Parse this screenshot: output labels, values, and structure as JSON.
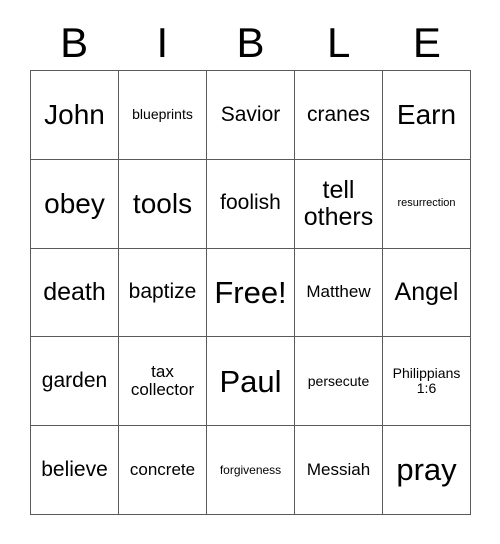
{
  "card": {
    "title_letters": [
      "B",
      "I",
      "B",
      "L",
      "E"
    ],
    "columns": 5,
    "rows": 5,
    "free_space_label": "Free!",
    "border_color": "#5a5a5a",
    "background_color": "#ffffff",
    "text_color": "#000000"
  },
  "grid": {
    "rows": [
      {
        "cells": [
          {
            "text": "John",
            "size": "sz-xl"
          },
          {
            "text": "blueprints",
            "size": "sz-xs"
          },
          {
            "text": "Savior",
            "size": "sz-md"
          },
          {
            "text": "cranes",
            "size": "sz-md"
          },
          {
            "text": "Earn",
            "size": "sz-xl"
          }
        ]
      },
      {
        "cells": [
          {
            "text": "obey",
            "size": "sz-xl"
          },
          {
            "text": "tools",
            "size": "sz-xl"
          },
          {
            "text": "foolish",
            "size": "sz-md"
          },
          {
            "text": "tell\nothers",
            "size": "sz-lg"
          },
          {
            "text": "resurrection",
            "size": "sz-tiny"
          }
        ]
      },
      {
        "cells": [
          {
            "text": "death",
            "size": "sz-lg"
          },
          {
            "text": "baptize",
            "size": "sz-md"
          },
          {
            "text": "Free!",
            "size": "sz-xxl"
          },
          {
            "text": "Matthew",
            "size": "sz-sm"
          },
          {
            "text": "Angel",
            "size": "sz-lg"
          }
        ]
      },
      {
        "cells": [
          {
            "text": "garden",
            "size": "sz-md"
          },
          {
            "text": "tax\ncollector",
            "size": "sz-sm"
          },
          {
            "text": "Paul",
            "size": "sz-xxl"
          },
          {
            "text": "persecute",
            "size": "sz-xs"
          },
          {
            "text": "Philippians\n1:6",
            "size": "sz-xs"
          }
        ]
      },
      {
        "cells": [
          {
            "text": "believe",
            "size": "sz-md"
          },
          {
            "text": "concrete",
            "size": "sz-sm"
          },
          {
            "text": "forgiveness",
            "size": "sz-xxs"
          },
          {
            "text": "Messiah",
            "size": "sz-sm"
          },
          {
            "text": "pray",
            "size": "sz-xxl"
          }
        ]
      }
    ]
  }
}
